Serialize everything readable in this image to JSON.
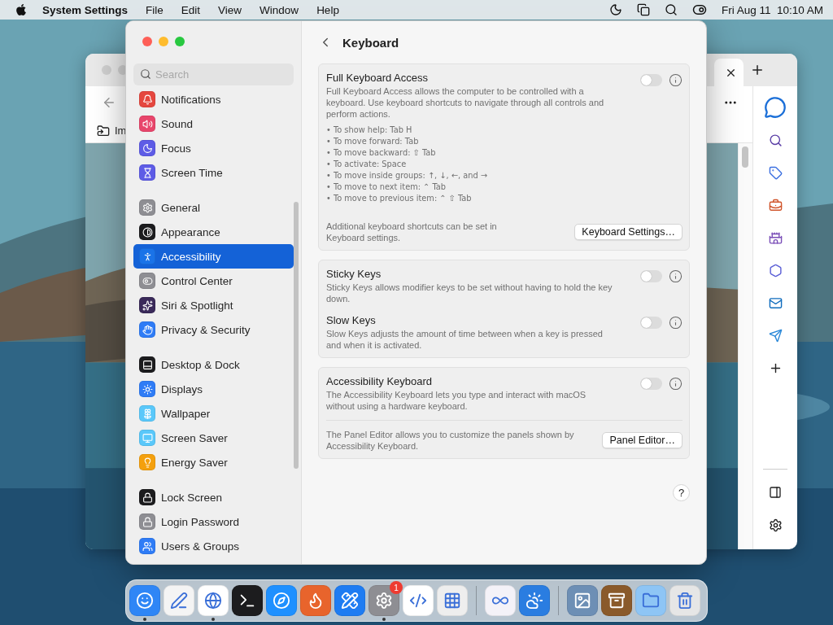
{
  "menubar": {
    "app": "System Settings",
    "menus": [
      "File",
      "Edit",
      "View",
      "Window",
      "Help"
    ],
    "clock": "Fri Aug 11  10:10 AM"
  },
  "browser": {
    "bookmark": "Im"
  },
  "settings": {
    "search": {
      "placeholder": "Search"
    },
    "sidebar": {
      "groups": [
        [
          {
            "label": "Notifications",
            "color": "#e5473f",
            "selected": false
          },
          {
            "label": "Sound",
            "color": "#e8456b",
            "selected": false
          },
          {
            "label": "Focus",
            "color": "#5e5ce6",
            "selected": false
          },
          {
            "label": "Screen Time",
            "color": "#5e5ce6",
            "selected": false
          }
        ],
        [
          {
            "label": "General",
            "color": "#8e8e93",
            "selected": false
          },
          {
            "label": "Appearance",
            "color": "#1c1c1e",
            "selected": false
          },
          {
            "label": "Accessibility",
            "color": "#1a73e8",
            "selected": true
          },
          {
            "label": "Control Center",
            "color": "#8e8e93",
            "selected": false
          },
          {
            "label": "Siri & Spotlight",
            "color": "#3a2a5a",
            "selected": false
          },
          {
            "label": "Privacy & Security",
            "color": "#2f7cf6",
            "selected": false
          }
        ],
        [
          {
            "label": "Desktop & Dock",
            "color": "#1c1c1e",
            "selected": false
          },
          {
            "label": "Displays",
            "color": "#2f7cf6",
            "selected": false
          },
          {
            "label": "Wallpaper",
            "color": "#5ac8fa",
            "selected": false
          },
          {
            "label": "Screen Saver",
            "color": "#5ac8fa",
            "selected": false
          },
          {
            "label": "Energy Saver",
            "color": "#f4a00e",
            "selected": false
          }
        ],
        [
          {
            "label": "Lock Screen",
            "color": "#1c1c1e",
            "selected": false
          },
          {
            "label": "Login Password",
            "color": "#8e8e93",
            "selected": false
          },
          {
            "label": "Users & Groups",
            "color": "#2f7cf6",
            "selected": false
          }
        ]
      ]
    },
    "title": "Keyboard",
    "cards": [
      {
        "rows": [
          {
            "title": "Full Keyboard Access",
            "description": "Full Keyboard Access allows the computer to be controlled with a keyboard. Use keyboard shortcuts to navigate through all controls and perform actions.",
            "bullets": [
              "• To show help: Tab H",
              "• To move forward: Tab",
              "• To move backward: ⇧ Tab",
              "• To activate: Space",
              "• To move inside groups: ↑, ↓, ←, and →",
              "• To move to next item: ⌃ Tab",
              "• To move to previous item: ⌃ ⇧ Tab"
            ],
            "on": false
          }
        ],
        "footer": {
          "text": "Additional keyboard shortcuts can be set in Keyboard settings.",
          "button": "Keyboard Settings…"
        }
      },
      {
        "rows": [
          {
            "title": "Sticky Keys",
            "description": "Sticky Keys allows modifier keys to be set without having to hold the key down.",
            "on": false
          },
          {
            "title": "Slow Keys",
            "description": "Slow Keys adjusts the amount of time between when a key is pressed and when it is activated.",
            "on": false
          }
        ]
      },
      {
        "rows": [
          {
            "title": "Accessibility Keyboard",
            "description": "The Accessibility Keyboard lets you type and interact with macOS without using a hardware keyboard.",
            "on": false
          }
        ],
        "footer": {
          "text": "The Panel Editor allows you to customize the panels shown by Accessibility Keyboard.",
          "button": "Panel Editor…"
        }
      }
    ],
    "help": "?"
  },
  "dock": {
    "groups": [
      [
        {
          "color": "#2f86f6",
          "running": true
        },
        {
          "color": "#f4f4f4",
          "running": false
        },
        {
          "color": "#ffffff",
          "running": true
        },
        {
          "color": "#1c1c1e",
          "running": false
        },
        {
          "color": "#1e90ff",
          "running": false
        },
        {
          "color": "#e8642c",
          "running": false
        },
        {
          "color": "#1e7cf2",
          "running": false
        },
        {
          "color": "#8e8e93",
          "running": true,
          "badge": "1"
        },
        {
          "color": "#ffffff",
          "running": false
        },
        {
          "color": "#eeeeee",
          "running": false
        }
      ],
      [
        {
          "color": "#f4f2f8",
          "running": false
        },
        {
          "color": "#2a7de1",
          "running": false
        }
      ],
      [
        {
          "color": "#6d8fb5",
          "running": false
        },
        {
          "color": "#8a5a2b",
          "running": false
        },
        {
          "color": "#8ec5f5",
          "running": false
        },
        {
          "color": "#e6e6e6",
          "running": false
        }
      ]
    ]
  }
}
